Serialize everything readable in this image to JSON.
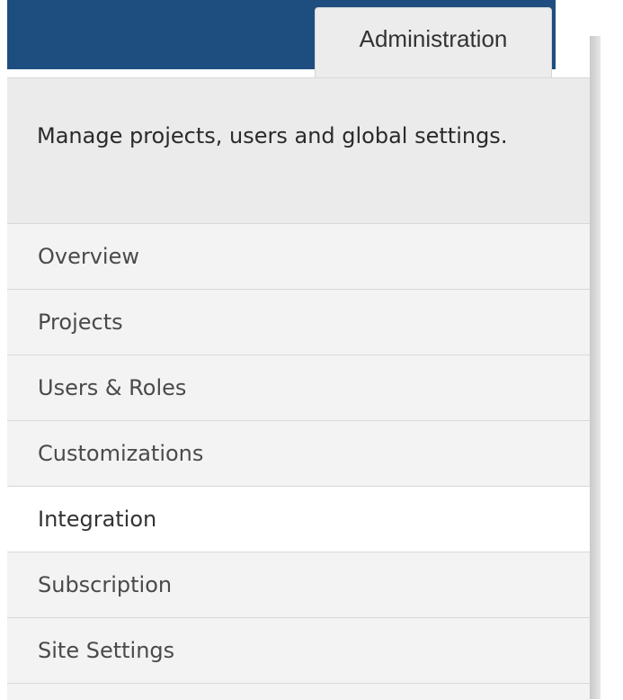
{
  "header": {
    "tab_label": "Administration"
  },
  "panel": {
    "description": "Manage projects, users and global settings."
  },
  "menu": {
    "items": [
      {
        "label": "Overview"
      },
      {
        "label": "Projects"
      },
      {
        "label": "Users & Roles"
      },
      {
        "label": "Customizations"
      },
      {
        "label": "Integration"
      },
      {
        "label": "Subscription"
      },
      {
        "label": "Site Settings"
      }
    ],
    "active_item": "Integration"
  },
  "colors": {
    "header_bar": "#1e4e7f",
    "tab_background": "#ececec",
    "panel_background": "#f3f3f3",
    "active_item_background": "#ffffff"
  }
}
